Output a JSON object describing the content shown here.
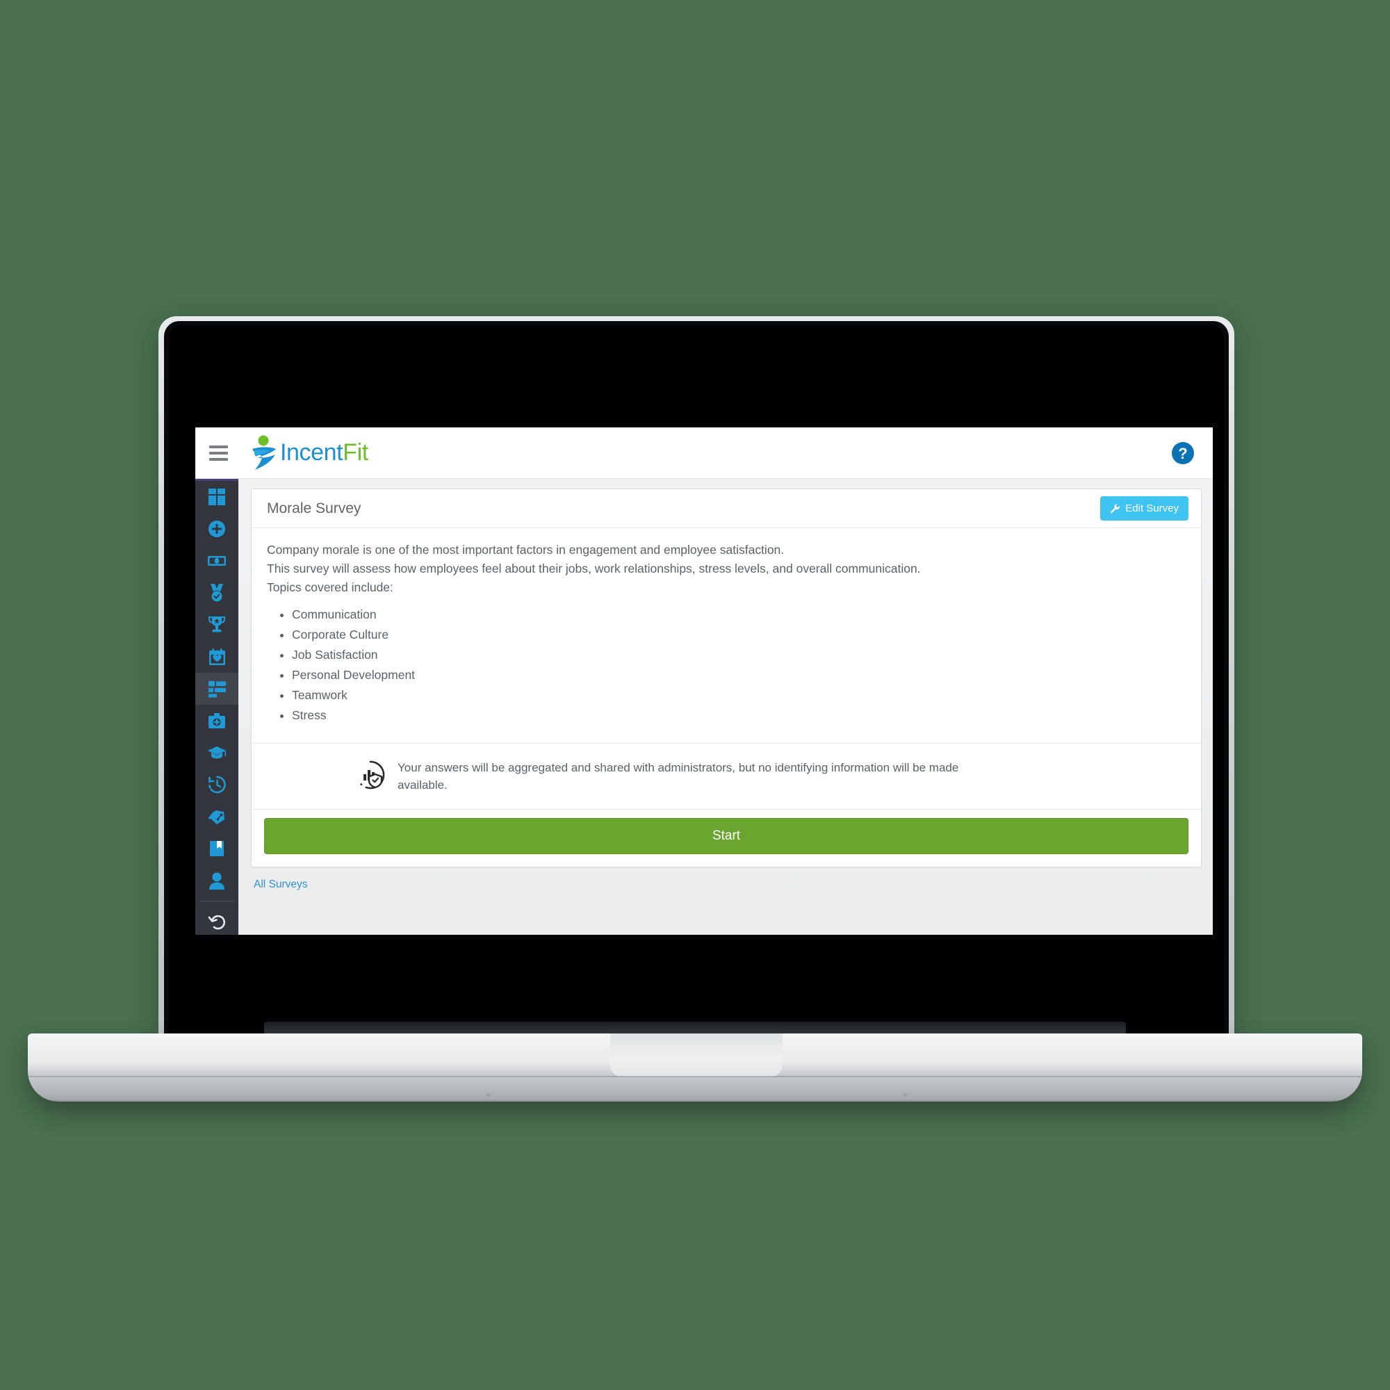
{
  "app": {
    "brand_name_part1": "Incent",
    "brand_name_part2": "Fit",
    "menu_icon": "hamburger-icon",
    "help_icon": "help-circle-icon"
  },
  "sidebar": {
    "items": [
      {
        "icon": "dashboard-grid-icon",
        "active": false
      },
      {
        "icon": "plus-circle-icon",
        "active": false
      },
      {
        "icon": "cash-money-icon",
        "active": false
      },
      {
        "icon": "medal-icon",
        "active": false
      },
      {
        "icon": "trophy-icon",
        "active": false
      },
      {
        "icon": "calendar-heart-icon",
        "active": false
      },
      {
        "icon": "survey-list-icon",
        "active": true
      },
      {
        "icon": "medkit-icon",
        "active": false
      },
      {
        "icon": "graduation-cap-icon",
        "active": false
      },
      {
        "icon": "history-clock-icon",
        "active": false
      },
      {
        "icon": "discount-tags-icon",
        "active": false
      },
      {
        "icon": "bookmark-book-icon",
        "active": false
      },
      {
        "icon": "user-person-icon",
        "active": false
      },
      {
        "icon": "undo-arrow-icon",
        "active": false
      }
    ]
  },
  "card": {
    "title": "Morale Survey",
    "edit_button_label": "Edit Survey",
    "edit_button_icon": "wrench-icon",
    "paragraphs": [
      "Company morale is one of the most important factors in engagement and employee satisfaction.",
      "This survey will assess how employees feel about their jobs, work relationships, stress levels, and overall communication.",
      "Topics covered include:"
    ],
    "topics": [
      "Communication",
      "Corporate Culture",
      "Job Satisfaction",
      "Personal Development",
      "Teamwork",
      "Stress"
    ],
    "notice": {
      "icon": "privacy-chart-shield-icon",
      "text": "Your answers will be aggregated and shared with administrators, but no identifying information will be made available."
    },
    "start_button_label": "Start"
  },
  "footer": {
    "all_surveys_link": "All Surveys"
  },
  "colors": {
    "page_background": "#4a7050",
    "brand_blue": "#1b8fd4",
    "brand_green": "#6cbe2b",
    "accent_cyan": "#3fc3f0",
    "start_green": "#6aa52f",
    "sidebar_dark": "#33373d",
    "sidebar_icon_blue": "#1f9ad6",
    "link_blue": "#2f93d6",
    "sidebar_top_accent": "#4a3f7a"
  }
}
